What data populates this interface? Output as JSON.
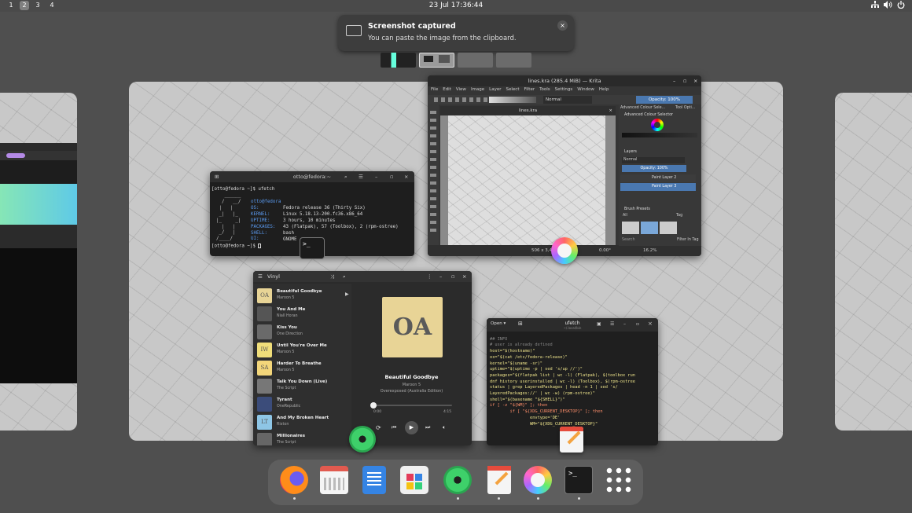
{
  "topbar": {
    "workspaces": [
      "1",
      "2",
      "3",
      "4"
    ],
    "active_workspace": "2",
    "clock": "23 Jul  17:36:44",
    "tray_icons": [
      "network-icon",
      "volume-icon",
      "power-icon"
    ]
  },
  "notification": {
    "title": "Screenshot captured",
    "body": "You can paste the image from the clipboard.",
    "close": "×"
  },
  "terminal": {
    "title": "otto@fedora:~",
    "prompt1": "[otto@fedora ~]$ ufetch",
    "user_host": "otto@fedora",
    "os_label": "OS:",
    "os": "Fedora release 36 (Thirty Six)",
    "kernel_label": "KERNEL:",
    "kernel": "Linux 5.18.13-200.fc36.x86_64",
    "uptime_label": "UPTIME:",
    "uptime": "3 hours, 10 minutes",
    "packages_label": "PACKAGES:",
    "packages": "43 (Flatpak), 57 (Toolbox), 2 (rpm-ostree)",
    "shell_label": "SHELL:",
    "shell": "bash",
    "ui_label": "UI:",
    "ui": "GNOME",
    "prompt2": "[otto@fedora ~]$ "
  },
  "krita": {
    "title": "lines.kra (285.4 MiB) — Krita",
    "menu": [
      "File",
      "Edit",
      "View",
      "Image",
      "Layer",
      "Select",
      "Filter",
      "Tools",
      "Settings",
      "Window",
      "Help"
    ],
    "blend_mode": "Normal",
    "opacity": "Opacity: 100%",
    "doc_tab": "lines.kra",
    "panel_tabs": [
      "Advanced Colour Sele...",
      "Tool Opti..."
    ],
    "colour_selector_title": "Advanced Colour Selector",
    "layers_title": "Layers",
    "layers_mode": "Normal",
    "layers_opacity": "Opacity: 100%",
    "layers": [
      "Paint Layer 2",
      "Paint Layer 3"
    ],
    "brush_presets_title": "Brush Presets",
    "brush_filter": "All",
    "brush_tag": "Tag",
    "search": "Search",
    "filter_in_tag": "Filter In Tag",
    "status_size": "506 x 3,4",
    "status_angle": "0.00°",
    "status_zoom": "16.2%"
  },
  "music": {
    "title": "Vinyl",
    "songs": [
      {
        "title": "Beautiful Goodbye",
        "artist": "Maroon 5",
        "art": "OA"
      },
      {
        "title": "You And Me",
        "artist": "Niall Horan",
        "art": ""
      },
      {
        "title": "Kiss You",
        "artist": "One Direction",
        "art": ""
      },
      {
        "title": "Until You're Over Me",
        "artist": "Maroon 5",
        "art": "IW"
      },
      {
        "title": "Harder To Breathe",
        "artist": "Maroon 5",
        "art": "SA"
      },
      {
        "title": "Talk You Down (Live)",
        "artist": "The Script",
        "art": ""
      },
      {
        "title": "Tyrant",
        "artist": "OneRepublic",
        "art": ""
      },
      {
        "title": "And My Broken Heart",
        "artist": "Rixton",
        "art": "LT"
      },
      {
        "title": "Millionaires",
        "artist": "The Script",
        "art": ""
      }
    ],
    "now_playing_art": "OA",
    "now_playing_title": "Beautiful Goodbye",
    "now_playing_artist": "Maroon 5",
    "now_playing_album": "Overexposed (Australia Edition)",
    "time_elapsed": "0:00",
    "time_total": "4:15",
    "progress": 0.0
  },
  "editor": {
    "open_label": "Open",
    "title": "ufetch",
    "subtitle": "~/.local/bin",
    "lines": [
      "## INFO",
      "",
      "# user is already defined",
      "host=\"$(hostname)\"",
      "os=\"$(cat /etc/fedora-release)\"",
      "kernel=\"$(uname -sr)\"",
      "uptime=\"$(uptime -p | sed 's/up //')\"",
      "packages=\"$(flatpak list | wc -l) (Flatpak), $(toolbox run",
      "dnf history userinstalled | wc -l) (Toolbox), $(rpm-ostree",
      "status | grep LayeredPackages | head -n 1 | sed 's/",
      "LayeredPackages://' | wc -w) (rpm-ostree)\"",
      "shell=\"$(basename \"${SHELL}\")\"",
      "",
      "if [ -z \"${WM}\" ]; then",
      "        if [ \"${XDG_CURRENT_DESKTOP}\" ]; then",
      "                envtype='DE'",
      "                WM=\"${XDG_CURRENT_DESKTOP}\""
    ]
  },
  "dock": {
    "apps": [
      "firefox",
      "calendar",
      "text-editor",
      "software",
      "vinyl",
      "gedit",
      "krita",
      "terminal",
      "show-apps"
    ]
  },
  "colors": {
    "accent": "#3584e4",
    "krita_blue": "#4a78b0",
    "album_yellow": "#e8d496"
  }
}
